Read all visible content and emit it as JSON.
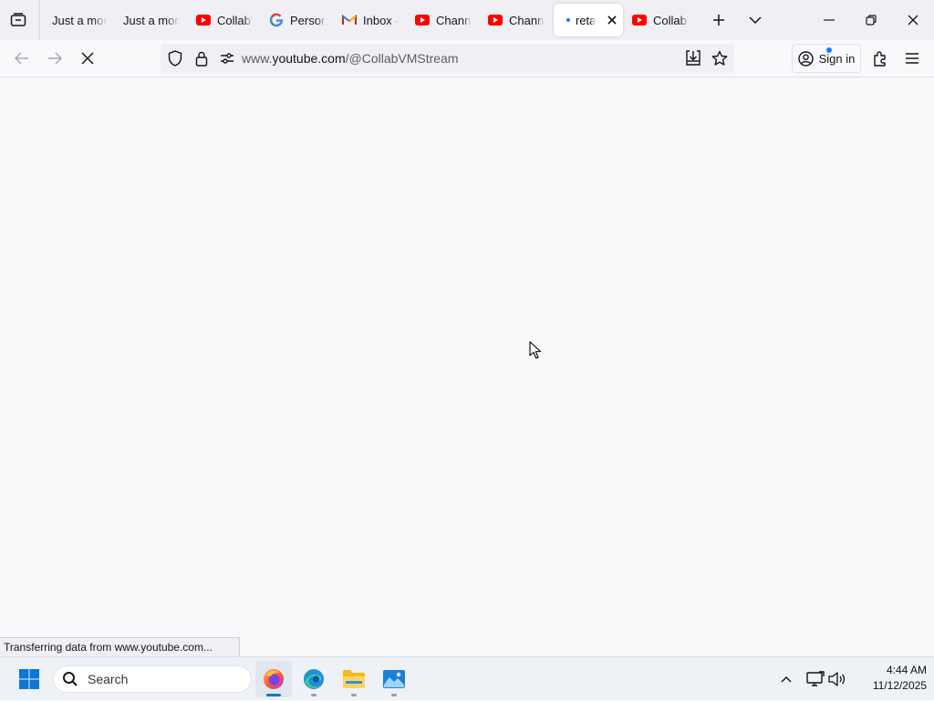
{
  "browser": {
    "tabs": [
      {
        "label": "Just a mom",
        "icon": "none",
        "active": false
      },
      {
        "label": "Just a mom",
        "icon": "none",
        "active": false
      },
      {
        "label": "CollabVM",
        "icon": "youtube-icon",
        "active": false
      },
      {
        "label": "Personal",
        "icon": "google-icon",
        "active": false
      },
      {
        "label": "Inbox -",
        "icon": "gmail-icon",
        "active": false
      },
      {
        "label": "Channel",
        "icon": "youtube-icon",
        "active": false
      },
      {
        "label": "Channel",
        "icon": "youtube-icon",
        "active": false
      },
      {
        "label": "retail",
        "icon": "loading-dot-icon",
        "active": true
      },
      {
        "label": "CollabVM",
        "icon": "youtube-icon",
        "active": false
      }
    ],
    "url_prefix": "www.",
    "url_host": "youtube.com",
    "url_path": "/@CollabVMStream",
    "sign_in_label": "Sign in",
    "status_text": "Transferring data from www.youtube.com..."
  },
  "taskbar": {
    "search_placeholder": "Search",
    "time": "4:44 AM",
    "date": "11/12/2025"
  },
  "colors": {
    "youtube_red": "#ff0000",
    "accent_blue": "#0a84ff",
    "tabbar_bg": "#f0f0f4",
    "page_bg": "#f9f9fb"
  }
}
